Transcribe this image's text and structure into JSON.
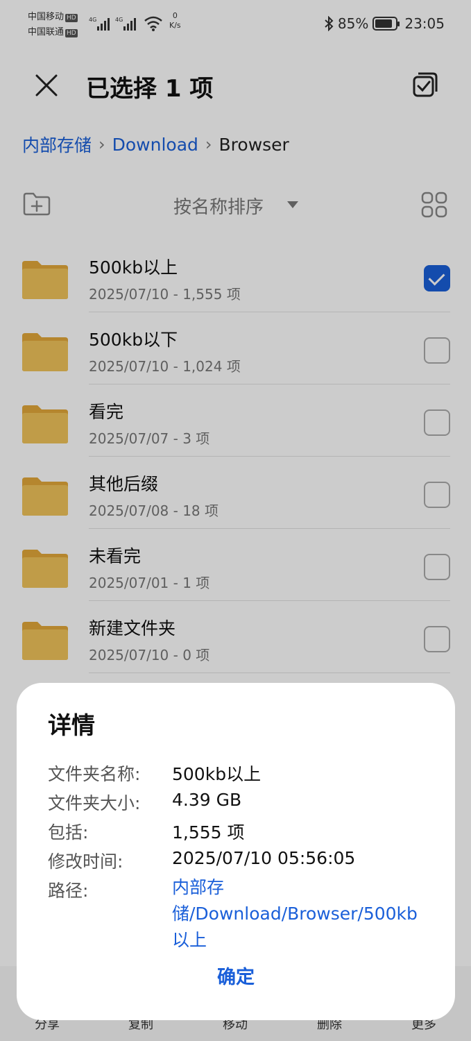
{
  "status_bar": {
    "carrier1": "中国移动",
    "carrier2": "中国联通",
    "hd": "HD",
    "net_speed_value": "0",
    "net_speed_unit": "K/s",
    "battery": "85%",
    "battery_level": 0.85,
    "time": "23:05"
  },
  "header": {
    "title": "已选择 1 项"
  },
  "breadcrumb": {
    "items": [
      "内部存储",
      "Download",
      "Browser"
    ]
  },
  "toolbar": {
    "sort_label": "按名称排序"
  },
  "files": [
    {
      "name": "500kb以上",
      "meta": "2025/07/10 - 1,555 项",
      "checked": true
    },
    {
      "name": "500kb以下",
      "meta": "2025/07/10 - 1,024 项",
      "checked": false
    },
    {
      "name": "看完",
      "meta": "2025/07/07 - 3 项",
      "checked": false
    },
    {
      "name": "其他后缀",
      "meta": "2025/07/08 - 18 项",
      "checked": false
    },
    {
      "name": "未看完",
      "meta": "2025/07/01 - 1 项",
      "checked": false
    },
    {
      "name": "新建文件夹",
      "meta": "2025/07/10 - 0 项",
      "checked": false
    }
  ],
  "bottom_bar": {
    "actions": [
      "分享",
      "复制",
      "移动",
      "删除",
      "更多"
    ]
  },
  "dialog": {
    "title": "详情",
    "rows": [
      {
        "label": "文件夹名称:",
        "value": "500kb以上"
      },
      {
        "label": "文件夹大小:",
        "value": "4.39 GB"
      },
      {
        "label": "包括:",
        "value": "1,555 项"
      },
      {
        "label": "修改时间:",
        "value": "2025/07/10 05:56:05"
      },
      {
        "label": "路径:",
        "value": "内部存储/Download/Browser/500kb以上"
      }
    ],
    "confirm_label": "确定"
  },
  "colors": {
    "accent": "#1a5fd9",
    "folder": "#f0c45a"
  }
}
